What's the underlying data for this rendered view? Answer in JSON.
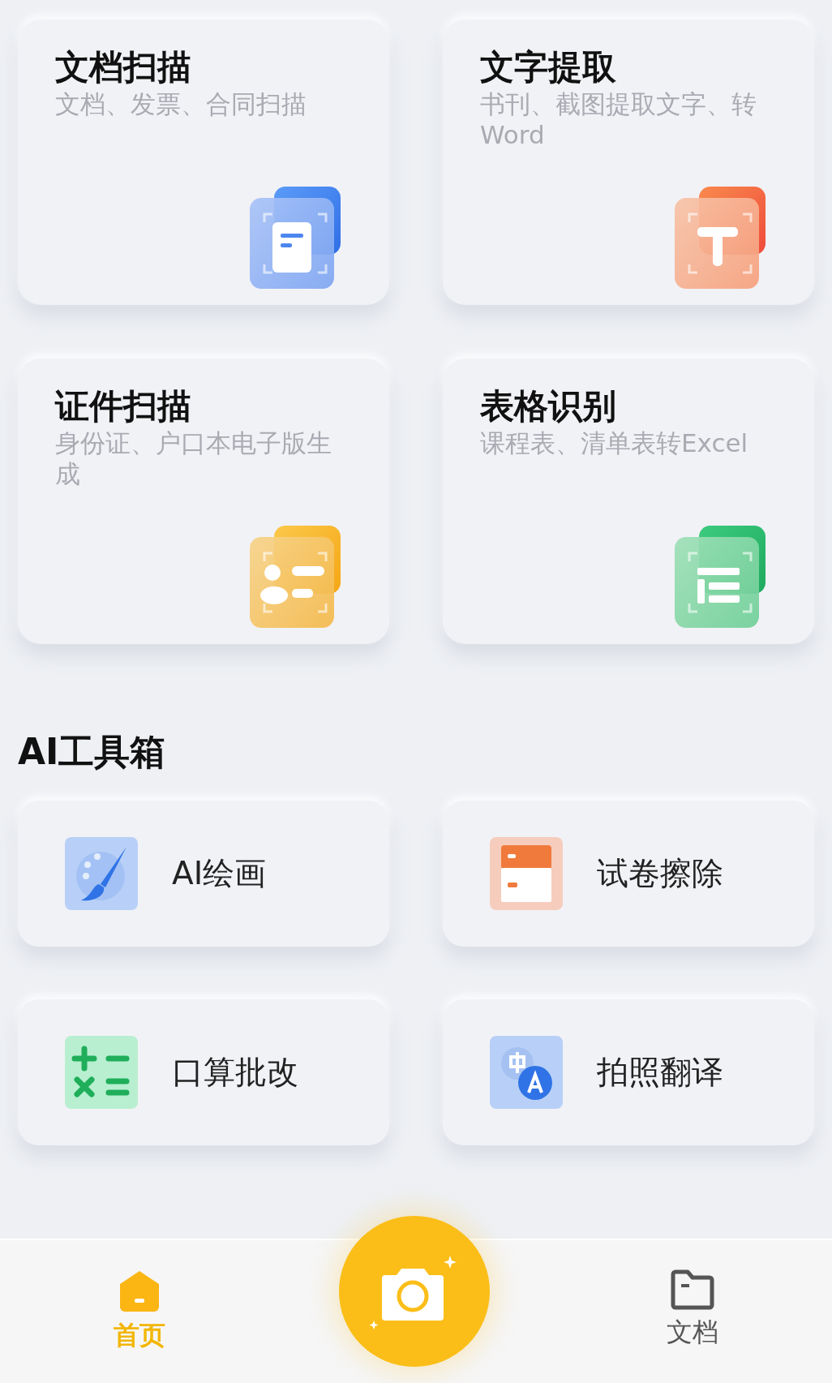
{
  "feature_cards": [
    {
      "title": "文档扫描",
      "subtitle": "文档、发票、合同扫描",
      "kind": "document"
    },
    {
      "title": "文字提取",
      "subtitle": "书刊、截图提取文字、转Word",
      "kind": "text"
    },
    {
      "title": "证件扫描",
      "subtitle": "身份证、户口本电子版生成",
      "kind": "idcard"
    },
    {
      "title": "表格识别",
      "subtitle": "课程表、清单表转Excel",
      "kind": "table"
    }
  ],
  "section_title": "AI工具箱",
  "tools": [
    {
      "label": "AI绘画",
      "kind": "paint"
    },
    {
      "label": "试卷擦除",
      "kind": "erase"
    },
    {
      "label": "口算批改",
      "kind": "math"
    },
    {
      "label": "拍照翻译",
      "kind": "translate"
    }
  ],
  "nav": {
    "items": [
      {
        "label": "首页",
        "kind": "home",
        "selected": true
      },
      {
        "label": "文档",
        "kind": "folder",
        "selected": false
      }
    ]
  }
}
